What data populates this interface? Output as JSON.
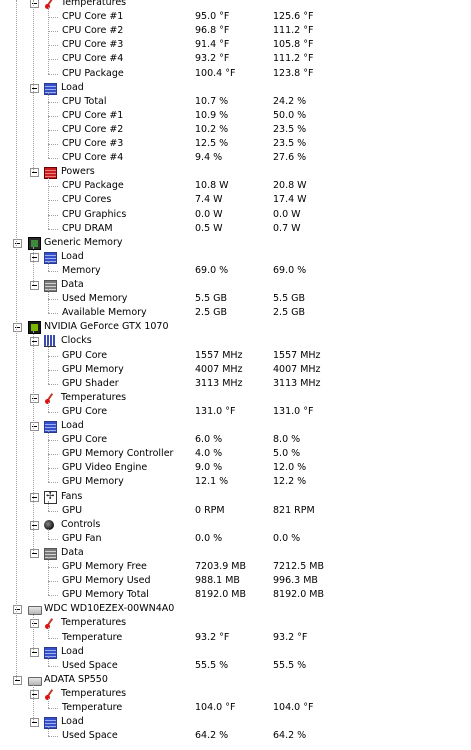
{
  "rows": [
    {
      "depth": 1,
      "kind": "group",
      "icon": "thermometer-icon",
      "label": "Temperatures"
    },
    {
      "depth": 2,
      "kind": "sensor",
      "label": "CPU Core #1",
      "value": "95.0 °F",
      "max": "125.6 °F"
    },
    {
      "depth": 2,
      "kind": "sensor",
      "label": "CPU Core #2",
      "value": "96.8 °F",
      "max": "111.2 °F"
    },
    {
      "depth": 2,
      "kind": "sensor",
      "label": "CPU Core #3",
      "value": "91.4 °F",
      "max": "105.8 °F"
    },
    {
      "depth": 2,
      "kind": "sensor",
      "label": "CPU Core #4",
      "value": "93.2 °F",
      "max": "111.2 °F"
    },
    {
      "depth": 2,
      "kind": "sensor",
      "label": "CPU Package",
      "value": "100.4 °F",
      "max": "123.8 °F"
    },
    {
      "depth": 1,
      "kind": "group",
      "icon": "load-icon",
      "label": "Load"
    },
    {
      "depth": 2,
      "kind": "sensor",
      "label": "CPU Total",
      "value": "10.7 %",
      "max": "24.2 %"
    },
    {
      "depth": 2,
      "kind": "sensor",
      "label": "CPU Core #1",
      "value": "10.9 %",
      "max": "50.0 %"
    },
    {
      "depth": 2,
      "kind": "sensor",
      "label": "CPU Core #2",
      "value": "10.2 %",
      "max": "23.5 %"
    },
    {
      "depth": 2,
      "kind": "sensor",
      "label": "CPU Core #3",
      "value": "12.5 %",
      "max": "23.5 %"
    },
    {
      "depth": 2,
      "kind": "sensor",
      "label": "CPU Core #4",
      "value": "9.4 %",
      "max": "27.6 %"
    },
    {
      "depth": 1,
      "kind": "group",
      "icon": "power-icon",
      "label": "Powers"
    },
    {
      "depth": 2,
      "kind": "sensor",
      "label": "CPU Package",
      "value": "10.8 W",
      "max": "20.8 W"
    },
    {
      "depth": 2,
      "kind": "sensor",
      "label": "CPU Cores",
      "value": "7.4 W",
      "max": "17.4 W"
    },
    {
      "depth": 2,
      "kind": "sensor",
      "label": "CPU Graphics",
      "value": "0.0 W",
      "max": "0.0 W"
    },
    {
      "depth": 2,
      "kind": "sensor",
      "label": "CPU DRAM",
      "value": "0.5 W",
      "max": "0.7 W"
    },
    {
      "depth": 0,
      "kind": "hardware",
      "icon": "memory-chip-icon",
      "label": "Generic Memory"
    },
    {
      "depth": 1,
      "kind": "group",
      "icon": "load-icon",
      "label": "Load"
    },
    {
      "depth": 2,
      "kind": "sensor",
      "label": "Memory",
      "value": "69.0 %",
      "max": "69.0 %"
    },
    {
      "depth": 1,
      "kind": "group",
      "icon": "data-icon",
      "label": "Data"
    },
    {
      "depth": 2,
      "kind": "sensor",
      "label": "Used Memory",
      "value": "5.5 GB",
      "max": "5.5 GB"
    },
    {
      "depth": 2,
      "kind": "sensor",
      "label": "Available Memory",
      "value": "2.5 GB",
      "max": "2.5 GB"
    },
    {
      "depth": 0,
      "kind": "hardware",
      "icon": "gpu-icon",
      "label": "NVIDIA GeForce GTX 1070"
    },
    {
      "depth": 1,
      "kind": "group",
      "icon": "clock-icon",
      "label": "Clocks"
    },
    {
      "depth": 2,
      "kind": "sensor",
      "label": "GPU Core",
      "value": "1557 MHz",
      "max": "1557 MHz"
    },
    {
      "depth": 2,
      "kind": "sensor",
      "label": "GPU Memory",
      "value": "4007 MHz",
      "max": "4007 MHz"
    },
    {
      "depth": 2,
      "kind": "sensor",
      "label": "GPU Shader",
      "value": "3113 MHz",
      "max": "3113 MHz"
    },
    {
      "depth": 1,
      "kind": "group",
      "icon": "thermometer-icon",
      "label": "Temperatures"
    },
    {
      "depth": 2,
      "kind": "sensor",
      "label": "GPU Core",
      "value": "131.0 °F",
      "max": "131.0 °F"
    },
    {
      "depth": 1,
      "kind": "group",
      "icon": "load-icon",
      "label": "Load"
    },
    {
      "depth": 2,
      "kind": "sensor",
      "label": "GPU Core",
      "value": "6.0 %",
      "max": "8.0 %"
    },
    {
      "depth": 2,
      "kind": "sensor",
      "label": "GPU Memory Controller",
      "value": "4.0 %",
      "max": "5.0 %"
    },
    {
      "depth": 2,
      "kind": "sensor",
      "label": "GPU Video Engine",
      "value": "9.0 %",
      "max": "12.0 %"
    },
    {
      "depth": 2,
      "kind": "sensor",
      "label": "GPU Memory",
      "value": "12.1 %",
      "max": "12.2 %"
    },
    {
      "depth": 1,
      "kind": "group",
      "icon": "fan-icon",
      "label": "Fans"
    },
    {
      "depth": 2,
      "kind": "sensor",
      "label": "GPU",
      "value": "0 RPM",
      "max": "821 RPM"
    },
    {
      "depth": 1,
      "kind": "group",
      "icon": "control-icon",
      "label": "Controls"
    },
    {
      "depth": 2,
      "kind": "sensor",
      "label": "GPU Fan",
      "value": "0.0 %",
      "max": "0.0 %"
    },
    {
      "depth": 1,
      "kind": "group",
      "icon": "data-icon",
      "label": "Data"
    },
    {
      "depth": 2,
      "kind": "sensor",
      "label": "GPU Memory Free",
      "value": "7203.9 MB",
      "max": "7212.5 MB"
    },
    {
      "depth": 2,
      "kind": "sensor",
      "label": "GPU Memory Used",
      "value": "988.1 MB",
      "max": "996.3 MB"
    },
    {
      "depth": 2,
      "kind": "sensor",
      "label": "GPU Memory Total",
      "value": "8192.0 MB",
      "max": "8192.0 MB"
    },
    {
      "depth": 0,
      "kind": "hardware",
      "icon": "hard-drive-icon",
      "label": "WDC WD10EZEX-00WN4A0"
    },
    {
      "depth": 1,
      "kind": "group",
      "icon": "thermometer-icon",
      "label": "Temperatures"
    },
    {
      "depth": 2,
      "kind": "sensor",
      "label": "Temperature",
      "value": "93.2 °F",
      "max": "93.2 °F"
    },
    {
      "depth": 1,
      "kind": "group",
      "icon": "load-icon",
      "label": "Load"
    },
    {
      "depth": 2,
      "kind": "sensor",
      "label": "Used Space",
      "value": "55.5 %",
      "max": "55.5 %"
    },
    {
      "depth": 0,
      "kind": "hardware",
      "icon": "hard-drive-icon",
      "label": "ADATA SP550"
    },
    {
      "depth": 1,
      "kind": "group",
      "icon": "thermometer-icon",
      "label": "Temperatures"
    },
    {
      "depth": 2,
      "kind": "sensor",
      "label": "Temperature",
      "value": "104.0 °F",
      "max": "104.0 °F"
    },
    {
      "depth": 1,
      "kind": "group",
      "icon": "load-icon",
      "label": "Load"
    },
    {
      "depth": 2,
      "kind": "sensor",
      "label": "Used Space",
      "value": "64.2 %",
      "max": "64.2 %"
    }
  ]
}
